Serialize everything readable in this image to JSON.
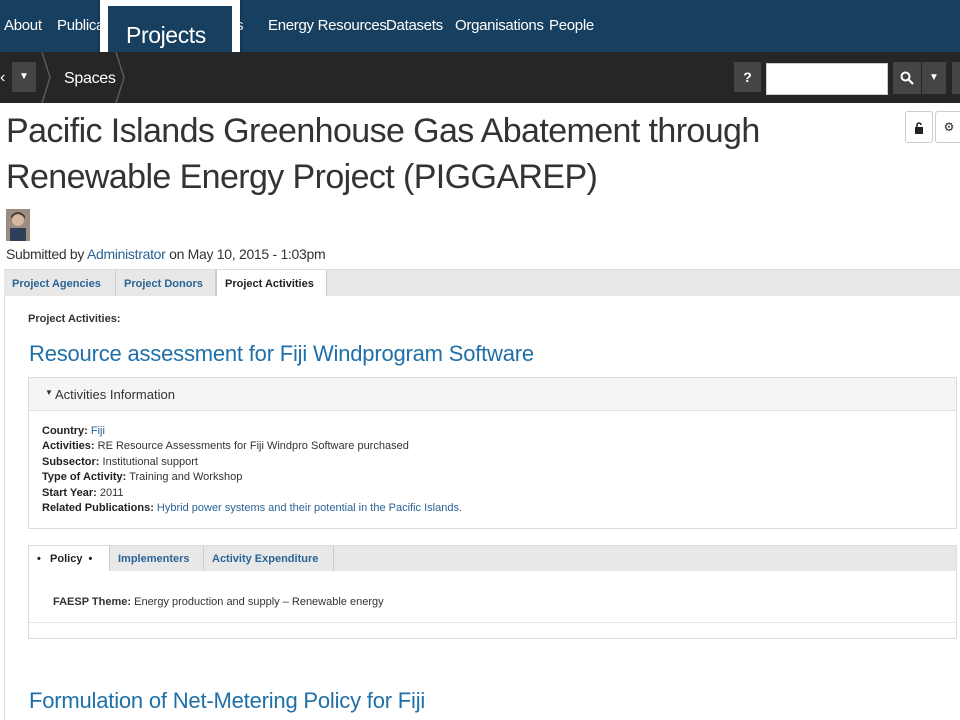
{
  "topnav": {
    "items": [
      "About",
      "Publicati",
      "s",
      "Energy Resources",
      "Datasets",
      "Organisations",
      "People"
    ],
    "active_popup": "Projects"
  },
  "subbar": {
    "breadcrumb": "Spaces",
    "help_label": "?",
    "search_placeholder": ""
  },
  "page": {
    "title": "Pacific Islands Greenhouse Gas Abatement through Renewable Energy Project (PIGGAREP)",
    "submitted_prefix": "Submitted by ",
    "submitted_author": "Administrator",
    "submitted_suffix": " on May 10, 2015 - 1:03pm"
  },
  "tabs": [
    "Project Agencies",
    "Project Donors",
    "Project Activities"
  ],
  "active_tab": "Project Activities",
  "project_activities_label": "Project Activities:",
  "activities": [
    {
      "heading": "Resource assessment for Fiji Windprogram Software",
      "info_title": "Activities Information",
      "fields": {
        "country_label": "Country:",
        "country_value": "Fiji",
        "activities_label": "Activities:",
        "activities_value": "RE Resource Assessments for Fiji Windpro Software purchased",
        "subsector_label": "Subsector:",
        "subsector_value": "Institutional support",
        "type_label": "Type of Activity:",
        "type_value": "Training and Workshop",
        "start_label": "Start Year:",
        "start_value": "2011",
        "pubs_label": "Related Publications:",
        "pubs_value": "Hybrid power systems and their potential in the Pacific Islands."
      },
      "subtabs": [
        "Policy",
        "Implementers",
        "Activity Expenditure"
      ],
      "active_subtab": "Policy",
      "faesp_label": "FAESP Theme:",
      "faesp_value": "Energy production and supply – Renewable energy"
    },
    {
      "heading": "Formulation of Net-Metering Policy for Fiji"
    }
  ],
  "colors": {
    "nav_bg": "#173f5f",
    "subbar_bg": "#262626",
    "link": "#2a6496",
    "heading": "#1f6fa8"
  },
  "icons": [
    "chevron-left-icon",
    "caret-down-icon",
    "help-icon",
    "search-icon",
    "lock-icon",
    "gear-icon",
    "caret-down-small-icon"
  ]
}
